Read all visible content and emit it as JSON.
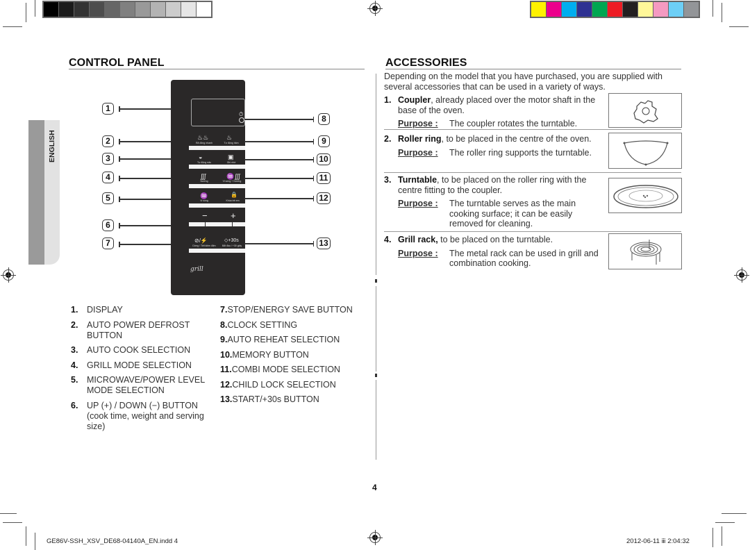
{
  "print_marks": {
    "gray_swatches": [
      "#000000",
      "#1b1b1b",
      "#333333",
      "#4d4d4d",
      "#666666",
      "#808080",
      "#999999",
      "#b3b3b3",
      "#cccccc",
      "#e6e6e6",
      "#ffffff"
    ],
    "color_swatches": [
      "#fff200",
      "#ec008c",
      "#00aeef",
      "#2e3192",
      "#00a651",
      "#ed1c24",
      "#231f20",
      "#fff799",
      "#f49ac1",
      "#6dcff6",
      "#939598"
    ]
  },
  "language_tab": "ENGLISH",
  "control_panel": {
    "title": "CONTROL PANEL",
    "callouts_left": [
      "1",
      "2",
      "3",
      "4",
      "5",
      "6",
      "7"
    ],
    "callouts_right": [
      "8",
      "9",
      "10",
      "11",
      "12",
      "13"
    ],
    "device": {
      "buttons": [
        {
          "icon": "♨♨",
          "label": "Rã đông nhanh"
        },
        {
          "icon": "♨",
          "label": "Tự động hâm"
        },
        {
          "icon": "◒",
          "label": "Tự động nấu"
        },
        {
          "icon": "▣",
          "label": "Ghi nhớ"
        },
        {
          "icon": "∭",
          "label": "Nướng"
        },
        {
          "icon": "♒∭",
          "label": "Vi sóng + Nướng"
        },
        {
          "icon": "♒",
          "label": "Vi sóng"
        },
        {
          "icon": "🔒",
          "label": "Khóa trẻ em"
        },
        {
          "icon": "⊘/⚡",
          "label": "Dừng / Tiết kiệm điện"
        },
        {
          "icon": "◇+30s",
          "label": "Bắt đầu / +30 giây"
        }
      ],
      "down_symbol": "−",
      "up_symbol": "+",
      "clock_icon": "⏱",
      "brand_mark": "grill"
    },
    "legend_left": [
      {
        "num": "1.",
        "text": "DISPLAY"
      },
      {
        "num": "2.",
        "text": "AUTO POWER DEFROST\nBUTTON"
      },
      {
        "num": "3.",
        "text": "AUTO COOK SELECTION"
      },
      {
        "num": "4.",
        "text": "GRILL MODE SELECTION"
      },
      {
        "num": "5.",
        "text": "MICROWAVE/POWER LEVEL\nMODE SELECTION"
      },
      {
        "num": "6.",
        "text": "UP (+) / DOWN (−) BUTTON\n(cook time, weight and serving\nsize)"
      }
    ],
    "legend_right": [
      {
        "num": "7.",
        "text": " STOP/ENERGY SAVE BUTTON"
      },
      {
        "num": "8.",
        "text": " CLOCK SETTING"
      },
      {
        "num": "9.",
        "text": " AUTO REHEAT SELECTION"
      },
      {
        "num": "10.",
        "text": "MEMORY BUTTON"
      },
      {
        "num": "11.",
        "text": "COMBI MODE SELECTION"
      },
      {
        "num": "12.",
        "text": "CHILD LOCK SELECTION"
      },
      {
        "num": "13.",
        "text": "START/+30s BUTTON"
      }
    ]
  },
  "accessories": {
    "title": "ACCESSORIES",
    "intro": "Depending on the model that you have purchased, you are supplied with several accessories that can be used in a variety of ways.",
    "purpose_label": "Purpose :",
    "items": [
      {
        "num": "1.",
        "name": "Coupler",
        "desc": ", already placed over the motor shaft in the base of the oven.",
        "purpose": "The coupler rotates the turntable.",
        "image": "coupler-image"
      },
      {
        "num": "2.",
        "name": "Roller ring",
        "desc": ", to be placed in the centre of the oven.",
        "purpose": "The roller ring supports the turntable.",
        "image": "roller-ring-image"
      },
      {
        "num": "3.",
        "name": "Turntable",
        "desc": ", to be placed on the roller ring with the centre fitting to the coupler.",
        "purpose": "The turntable serves as the main cooking surface; it can be easily removed for cleaning.",
        "image": "turntable-image"
      },
      {
        "num": "4.",
        "name": "Grill rack,",
        "desc": " to be placed on the turntable.",
        "purpose": "The metal rack can be used in grill and combination cooking.",
        "image": "grill-rack-image"
      }
    ]
  },
  "page_number": "4",
  "footer": {
    "file": "GE86V-SSH_XSV_DE68-04140A_EN.indd   4",
    "timestamp": "2012-06-11   ⅲ 2:04:32"
  }
}
